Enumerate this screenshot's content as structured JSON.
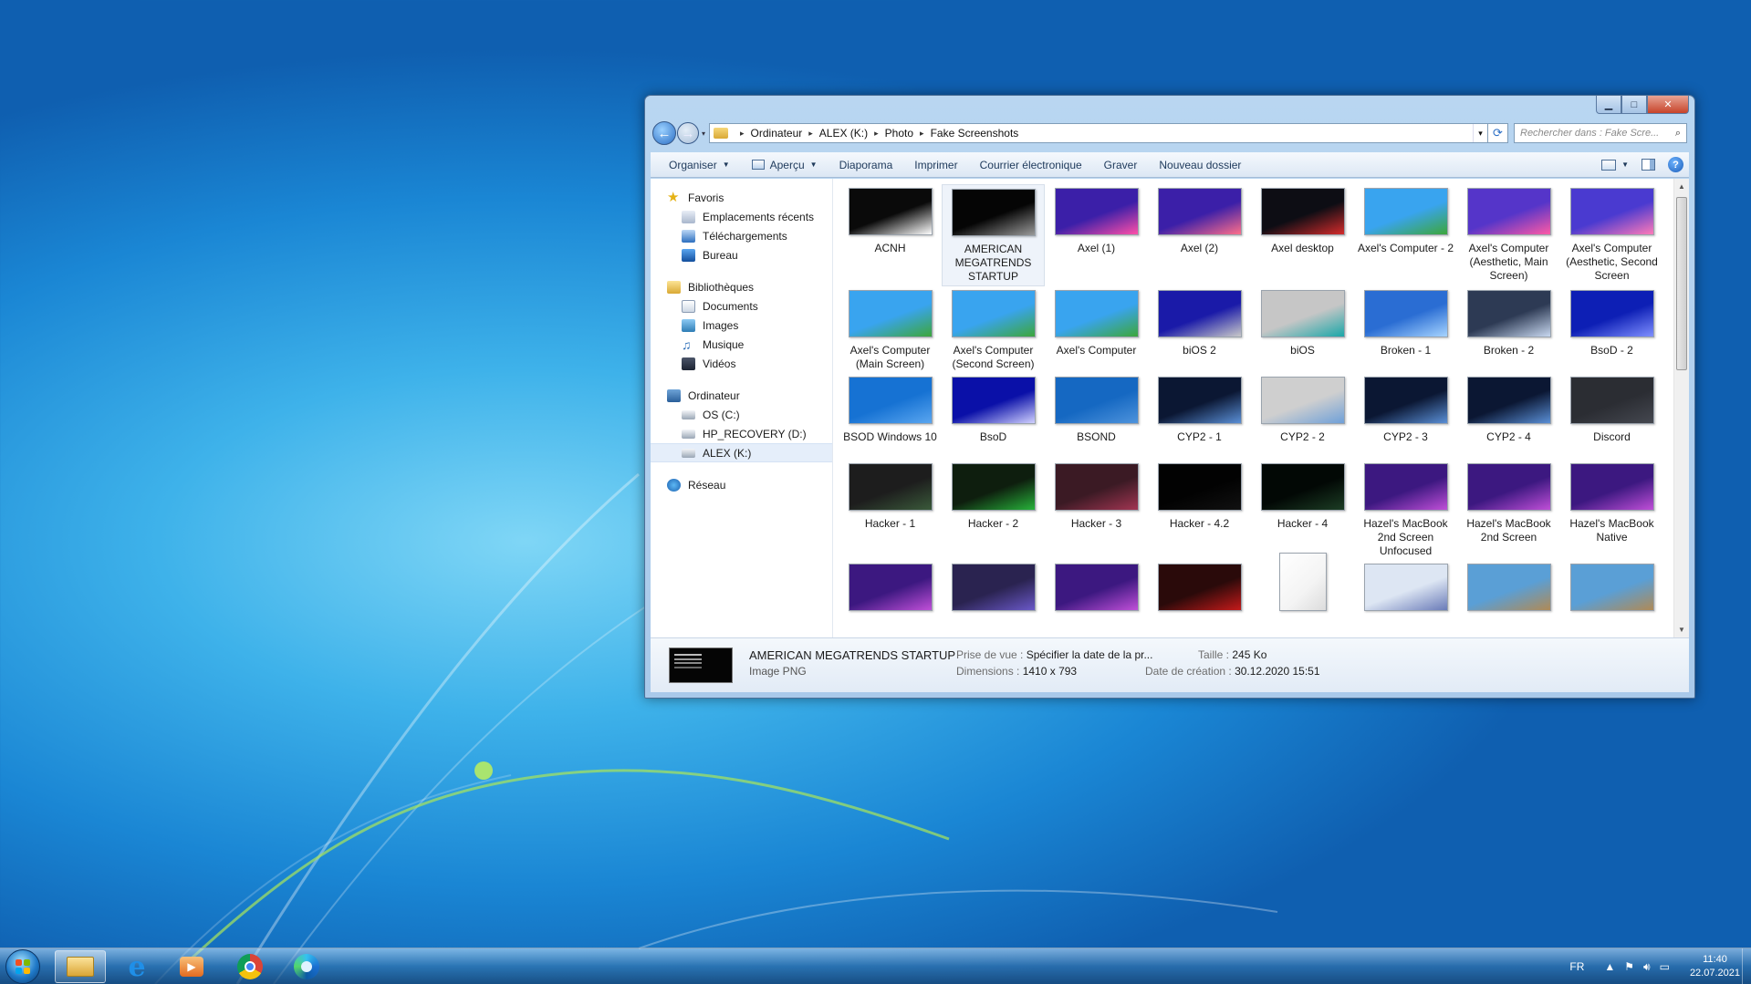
{
  "window": {
    "controls": {
      "minimize": "▁",
      "maximize": "□",
      "close": "✕"
    },
    "nav": {
      "back_glyph": "←",
      "forward_glyph": "→",
      "recent_glyph": "▾"
    },
    "breadcrumb": [
      "Ordinateur",
      "ALEX (K:)",
      "Photo",
      "Fake Screenshots"
    ],
    "search_placeholder": "Rechercher dans : Fake Scre...",
    "toolbar": {
      "organize": "Organiser",
      "preview": "Aperçu",
      "slideshow": "Diaporama",
      "print": "Imprimer",
      "email": "Courrier électronique",
      "burn": "Graver",
      "new_folder": "Nouveau dossier",
      "help": "?"
    },
    "sidebar": {
      "favorites": {
        "label": "Favoris",
        "items": [
          "Emplacements récents",
          "Téléchargements",
          "Bureau"
        ]
      },
      "libraries": {
        "label": "Bibliothèques",
        "items": [
          "Documents",
          "Images",
          "Musique",
          "Vidéos"
        ]
      },
      "computer": {
        "label": "Ordinateur",
        "items": [
          "OS (C:)",
          "HP_RECOVERY (D:)",
          "ALEX (K:)"
        ],
        "selected": "ALEX (K:)"
      },
      "network": {
        "label": "Réseau"
      }
    },
    "files": [
      {
        "label": "ACNH",
        "bg": "#0a0a0a",
        "accent": "#ffffff"
      },
      {
        "label": "AMERICAN MEGATRENDS STARTUP",
        "bg": "#050505",
        "accent": "#9a9a9a",
        "selected": true
      },
      {
        "label": "Axel (1)",
        "bg": "#3b1fa8",
        "accent": "#ff4fa8"
      },
      {
        "label": "Axel (2)",
        "bg": "#3b1fa8",
        "accent": "#ff6f8a"
      },
      {
        "label": "Axel desktop",
        "bg": "#0d0d14",
        "accent": "#d52b2b"
      },
      {
        "label": "Axel's Computer - 2",
        "bg": "#39a4ef",
        "accent": "#3da63a"
      },
      {
        "label": "Axel's Computer (Aesthetic, Main Screen)",
        "bg": "#5535c9",
        "accent": "#ff5aa5"
      },
      {
        "label": "Axel's Computer (Aesthetic, Second Screen",
        "bg": "#4a3ad0",
        "accent": "#ff7ab8"
      },
      {
        "label": "Axel's Computer (Main Screen)",
        "bg": "#39a4ef",
        "accent": "#3da63a"
      },
      {
        "label": "Axel's Computer (Second Screen)",
        "bg": "#39a4ef",
        "accent": "#3da63a"
      },
      {
        "label": "Axel's Computer",
        "bg": "#39a4ef",
        "accent": "#3da63a"
      },
      {
        "label": "biOS 2",
        "bg": "#1a1aa8",
        "accent": "#c9c9c9"
      },
      {
        "label": "biOS",
        "bg": "#c6c6c6",
        "accent": "#1aa7a8"
      },
      {
        "label": "Broken - 1",
        "bg": "#2a6dd3",
        "accent": "#a6d4ff"
      },
      {
        "label": "Broken - 2",
        "bg": "#2d3a54",
        "accent": "#c8d8f0"
      },
      {
        "label": "BsoD - 2",
        "bg": "#0d1fb5",
        "accent": "#7f8fff"
      },
      {
        "label": "BSOD Windows 10",
        "bg": "#1672d3",
        "accent": "#5aa6f0"
      },
      {
        "label": "BsoD",
        "bg": "#0a10a8",
        "accent": "#d0d0ff"
      },
      {
        "label": "BSOND",
        "bg": "#1568c2",
        "accent": "#4e93dc"
      },
      {
        "label": "CYP2 - 1",
        "bg": "#0b1733",
        "accent": "#5a8fd6"
      },
      {
        "label": "CYP2 - 2",
        "bg": "#cfcfcf",
        "accent": "#6fa0d8"
      },
      {
        "label": "CYP2 - 3",
        "bg": "#0b1733",
        "accent": "#5a8fd6"
      },
      {
        "label": "CYP2 - 4",
        "bg": "#0b1733",
        "accent": "#5a8fd6"
      },
      {
        "label": "Discord",
        "bg": "#2b2d33",
        "accent": "#454850"
      },
      {
        "label": "Hacker - 1",
        "bg": "#1d1d1d",
        "accent": "#3a5a3a"
      },
      {
        "label": "Hacker - 2",
        "bg": "#0e1e0e",
        "accent": "#27b23a"
      },
      {
        "label": "Hacker - 3",
        "bg": "#3b1a24",
        "accent": "#a23552"
      },
      {
        "label": "Hacker - 4.2",
        "bg": "#020202",
        "accent": "#111111"
      },
      {
        "label": "Hacker - 4",
        "bg": "#020805",
        "accent": "#1c3d24"
      },
      {
        "label": "Hazel's MacBook 2nd Screen Unfocused",
        "bg": "#3c1880",
        "accent": "#c04fd8"
      },
      {
        "label": "Hazel's MacBook 2nd Screen",
        "bg": "#3c1880",
        "accent": "#c04fd8"
      },
      {
        "label": "Hazel's MacBook Native",
        "bg": "#3c1880",
        "accent": "#c04fd8"
      },
      {
        "label": "",
        "bg": "#3c1880",
        "accent": "#c04fd8"
      },
      {
        "label": "",
        "bg": "#2a2350",
        "accent": "#6a58c8"
      },
      {
        "label": "",
        "bg": "#3c1880",
        "accent": "#c04fd8"
      },
      {
        "label": "",
        "bg": "#2a0a0a",
        "accent": "#c41a1a"
      },
      {
        "label": "",
        "bg": "#f4f4f4",
        "accent": "#dcdcdc",
        "file_icon": true
      },
      {
        "label": "",
        "bg": "#dde6f3",
        "accent": "#6a7bb8"
      },
      {
        "label": "",
        "bg": "#5a9fd6",
        "accent": "#b08a56"
      },
      {
        "label": "",
        "bg": "#5a9fd6",
        "accent": "#b08a56"
      }
    ],
    "details": {
      "name": "AMERICAN MEGATRENDS STARTUP",
      "type": "Image PNG",
      "taken_label": "Prise de vue :",
      "taken_value": "Spécifier la date de la pr...",
      "size_label": "Taille :",
      "size_value": "245 Ko",
      "dimensions_label": "Dimensions :",
      "dimensions_value": "1410 x 793",
      "created_label": "Date de création :",
      "created_value": "30.12.2020 15:51"
    }
  },
  "taskbar": {
    "language": "FR",
    "time": "11:40",
    "date": "22.07.2021",
    "media_glyph": "▶"
  }
}
